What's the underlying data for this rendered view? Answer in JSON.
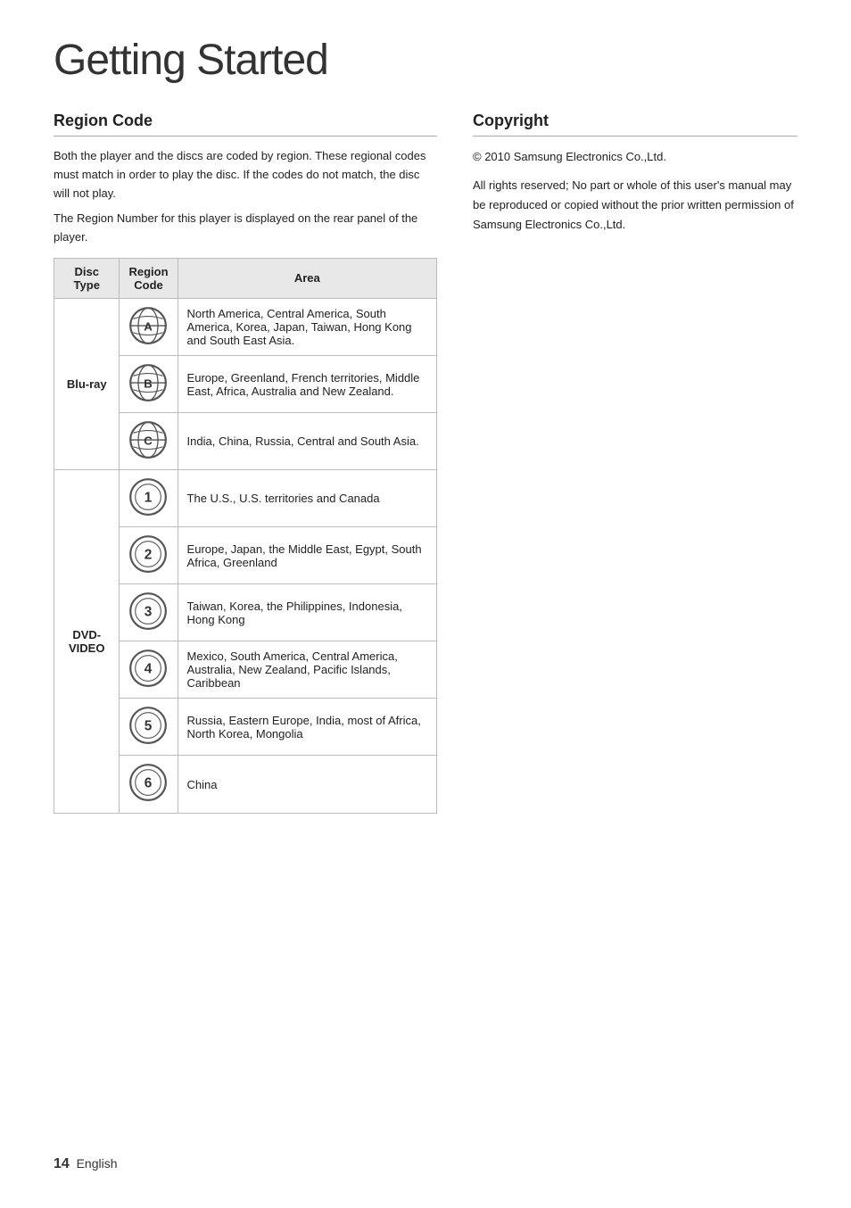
{
  "page": {
    "title": "Getting Started",
    "footer": {
      "page_number": "14",
      "language": "English"
    }
  },
  "region_code": {
    "section_title": "Region Code",
    "description1": "Both the player and the discs are coded by region. These regional codes must match in order to play the disc. If the codes do not match, the disc will not play.",
    "description2": "The Region Number for this player is displayed on the rear panel of the player.",
    "table": {
      "headers": [
        "Disc Type",
        "Region Code",
        "Area"
      ],
      "rows": [
        {
          "disc_type": "Blu-ray",
          "disc_type_rowspan": 3,
          "icon": "A",
          "icon_type": "bluray",
          "area": "North America, Central America, South America, Korea, Japan, Taiwan, Hong Kong and South East Asia."
        },
        {
          "disc_type": "",
          "icon": "B",
          "icon_type": "bluray",
          "area": "Europe, Greenland, French territories, Middle East, Africa, Australia and New Zealand."
        },
        {
          "disc_type": "",
          "icon": "C",
          "icon_type": "bluray",
          "area": "India, China, Russia, Central and South Asia."
        },
        {
          "disc_type": "DVD-VIDEO",
          "disc_type_rowspan": 6,
          "icon": "1",
          "icon_type": "dvd",
          "area": "The U.S., U.S. territories and Canada"
        },
        {
          "disc_type": "",
          "icon": "2",
          "icon_type": "dvd",
          "area": "Europe, Japan, the Middle East, Egypt, South Africa, Greenland"
        },
        {
          "disc_type": "",
          "icon": "3",
          "icon_type": "dvd",
          "area": "Taiwan, Korea, the Philippines, Indonesia, Hong Kong"
        },
        {
          "disc_type": "",
          "icon": "4",
          "icon_type": "dvd",
          "area": "Mexico, South America, Central America, Australia, New Zealand, Pacific Islands, Caribbean"
        },
        {
          "disc_type": "",
          "icon": "5",
          "icon_type": "dvd",
          "area": "Russia, Eastern Europe, India, most of Africa, North Korea, Mongolia"
        },
        {
          "disc_type": "",
          "icon": "6",
          "icon_type": "dvd",
          "area": "China"
        }
      ]
    }
  },
  "copyright": {
    "section_title": "Copyright",
    "line1": "© 2010 Samsung Electronics Co.,Ltd.",
    "line2": "All rights reserved; No part or whole of this user's manual may be reproduced or copied without the prior written permission of Samsung Electronics Co.,Ltd."
  }
}
